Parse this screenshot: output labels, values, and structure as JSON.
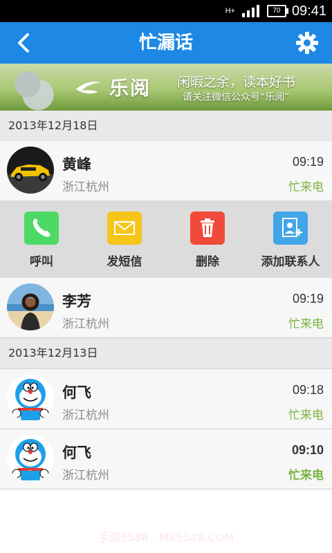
{
  "status_bar": {
    "network": "H+",
    "battery": "70",
    "time": "09:41"
  },
  "header": {
    "title": "忙漏话",
    "back_icon": "chevron-left-icon",
    "settings_icon": "gear-icon",
    "color": "#1e88e5"
  },
  "banner": {
    "logo_text": "乐阅",
    "slogan": "闲暇之余，读本好书",
    "subtitle": "请关注微信公众号“乐阅”"
  },
  "sections": [
    {
      "date": "2013年12月18日",
      "calls": [
        {
          "name": "黄峰",
          "location": "浙江杭州",
          "time": "09:19",
          "status": "忙来电"
        }
      ],
      "actions": [
        {
          "label": "呼叫",
          "icon": "phone-icon",
          "color": "#4cd964"
        },
        {
          "label": "发短信",
          "icon": "envelope-icon",
          "color": "#f5c518"
        },
        {
          "label": "删除",
          "icon": "trash-icon",
          "color": "#ef4a3a"
        },
        {
          "label": "添加联系人",
          "icon": "add-contact-icon",
          "color": "#42a5e8"
        }
      ],
      "calls_after": [
        {
          "name": "李芳",
          "location": "浙江杭州",
          "time": "09:19",
          "status": "忙来电"
        }
      ]
    },
    {
      "date": "2013年12月13日",
      "calls": [
        {
          "name": "何飞",
          "location": "浙江杭州",
          "time": "09:18",
          "status": "忙来电"
        },
        {
          "name": "何飞",
          "location": "浙江杭州",
          "time": "09:10",
          "status": "忙来电"
        }
      ]
    }
  ],
  "watermark": "手游5588 · MX5588.COM"
}
